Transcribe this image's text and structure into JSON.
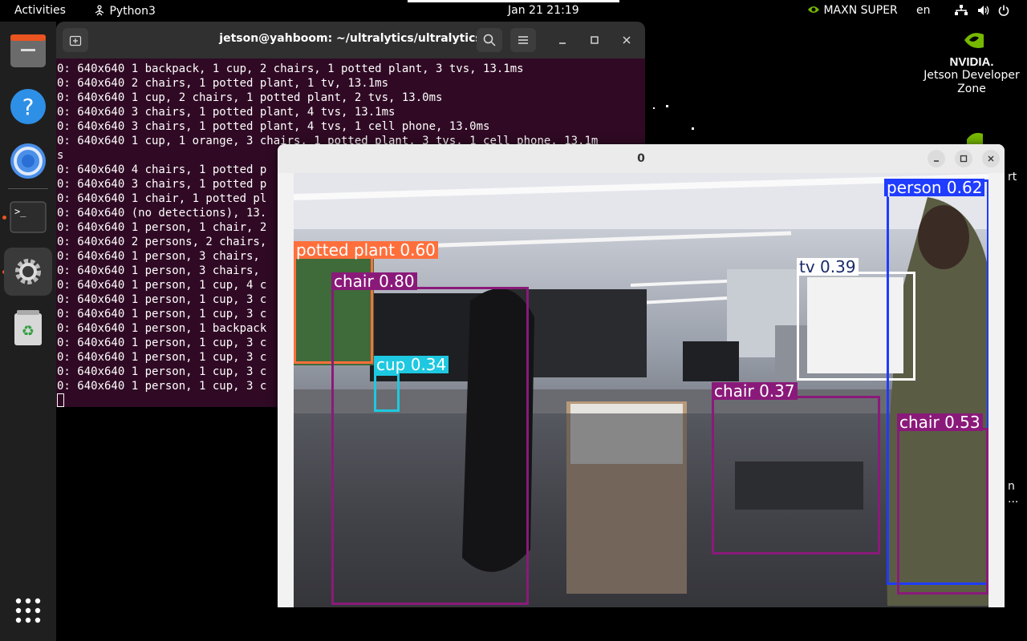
{
  "topbar": {
    "activities": "Activities",
    "app_name": "Python3",
    "clock": "Jan 21  21:19",
    "power_mode": "MAXN SUPER",
    "language": "en"
  },
  "terminal": {
    "title": "jetson@yahboom: ~/ultralytics/ultralytics",
    "lines": [
      "0: 640x640 1 backpack, 1 cup, 2 chairs, 1 potted plant, 3 tvs, 13.1ms",
      "0: 640x640 2 chairs, 1 potted plant, 1 tv, 13.1ms",
      "0: 640x640 1 cup, 2 chairs, 1 potted plant, 2 tvs, 13.0ms",
      "0: 640x640 3 chairs, 1 potted plant, 4 tvs, 13.1ms",
      "0: 640x640 3 chairs, 1 potted plant, 4 tvs, 1 cell phone, 13.0ms",
      "0: 640x640 1 cup, 1 orange, 3 chairs, 1 potted plant, 3 tvs, 1 cell phone, 13.1m",
      "s",
      "0: 640x640 4 chairs, 1 potted p",
      "0: 640x640 3 chairs, 1 potted p",
      "0: 640x640 1 chair, 1 potted pl",
      "0: 640x640 (no detections), 13.",
      "0: 640x640 1 person, 1 chair, 2",
      "0: 640x640 2 persons, 2 chairs,",
      "0: 640x640 1 person, 3 chairs,",
      "0: 640x640 1 person, 3 chairs,",
      "0: 640x640 1 person, 1 cup, 4 c",
      "0: 640x640 1 person, 1 cup, 3 c",
      "0: 640x640 1 person, 1 cup, 3 c",
      "0: 640x640 1 person, 1 backpack",
      "0: 640x640 1 person, 1 cup, 3 c",
      "0: 640x640 1 person, 1 cup, 3 c",
      "0: 640x640 1 person, 1 cup, 3 c",
      "0: 640x640 1 person, 1 cup, 3 c"
    ]
  },
  "image_window": {
    "title": "0",
    "detections": [
      {
        "label": "potted plant 0.60",
        "color": "#ff6f3c"
      },
      {
        "label": "chair 0.80",
        "color": "#8a1a7a"
      },
      {
        "label": "cup 0.34",
        "color": "#1ec8e0"
      },
      {
        "label": "tv 0.39",
        "color": "#ffffff"
      },
      {
        "label": "chair 0.37",
        "color": "#8a1a7a"
      },
      {
        "label": "person 0.62",
        "color": "#1f3cff"
      },
      {
        "label": "chair 0.53",
        "color": "#8a1a7a"
      }
    ]
  },
  "desktop": {
    "nvidia_wordmark": "NVIDIA.",
    "jetson_label": "Jetson Developer Zone",
    "partial_text_1": "rt",
    "partial_text_2": "n",
    "partial_text_3": "..."
  },
  "colors": {
    "terminal_bg": "#300a24",
    "ubuntu_orange": "#e95420",
    "nvidia_green": "#76b900"
  }
}
